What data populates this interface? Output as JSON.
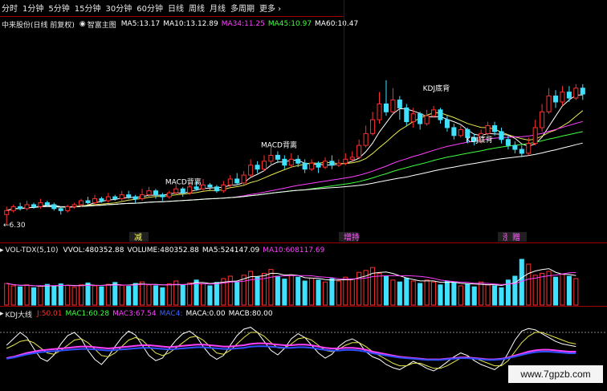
{
  "toolbar": {
    "items": [
      "分时",
      "1分钟",
      "5分钟",
      "15分钟",
      "30分钟",
      "60分钟",
      "日线",
      "周线",
      "月线",
      "多周期",
      "更多"
    ]
  },
  "main_panel": {
    "title": "中来股份(日线 前复权)",
    "indicator": "智富主图",
    "ma": [
      {
        "label": "MA5:",
        "value": "13.17",
        "color": "#ffffff"
      },
      {
        "label": "MA10:",
        "value": "13.12.89",
        "color": "#ffffff"
      },
      {
        "label": "MA34:",
        "value": "11.25",
        "color": "#ff40ff"
      },
      {
        "label": "MA45:",
        "value": "10.97",
        "color": "#40ff40"
      },
      {
        "label": "MA60:",
        "value": "10.47",
        "color": "#ffffff"
      }
    ],
    "low_price": "6.30",
    "annotations": [
      "MACD背离",
      "MACD背离",
      "KDJ底背",
      "KDJ底背"
    ],
    "bottom_markers": [
      "减",
      "增持",
      "涨",
      "赠"
    ]
  },
  "vol_panel": {
    "title": "VOL-TDX(5,10)",
    "items": [
      {
        "label": "VVOL:",
        "value": "480352.88",
        "color": "#ffffff"
      },
      {
        "label": "VOLUME:",
        "value": "480352.88",
        "color": "#ffffff"
      },
      {
        "label": "MA5:",
        "value": "524147.09",
        "color": "#ffffff"
      },
      {
        "label": "MA10:",
        "value": "608117.69",
        "color": "#ff40ff"
      }
    ]
  },
  "kdj_panel": {
    "title": "KDJ大线",
    "items": [
      {
        "label": "J:",
        "value": "50.01",
        "color": "#ff3030"
      },
      {
        "label": "MAC1:",
        "value": "60.28",
        "color": "#40ff40"
      },
      {
        "label": "MAC3:",
        "value": "67.54",
        "color": "#ff40ff"
      },
      {
        "label": "MAC4:",
        "value": "",
        "color": "#4060ff"
      },
      {
        "label": "MACA:",
        "value": "0.00",
        "color": "#ffffff"
      },
      {
        "label": "MACB:",
        "value": "80.00",
        "color": "#ffffff"
      }
    ]
  },
  "watermark": "www.7gpzb.com",
  "chart_data": {
    "type": "candlestick",
    "title": "中来股份(日线 前复权)",
    "y_min_label": 6.3,
    "series_names": [
      "MA5",
      "MA10",
      "MA34",
      "MA45",
      "MA60"
    ],
    "colors": {
      "up": "#ff3030",
      "down": "#40e0ff",
      "ma5": "#ffffff",
      "ma10": "#e8e850",
      "ma34": "#ff40ff",
      "ma45": "#40ff40",
      "ma60": "#ffffff",
      "k": "#ffffff",
      "d": "#e8e850",
      "j": "#ff40ff"
    },
    "candles": [
      {
        "o": 6.8,
        "c": 7.0,
        "h": 7.2,
        "l": 6.3
      },
      {
        "o": 7.0,
        "c": 7.2,
        "h": 7.3,
        "l": 6.9
      },
      {
        "o": 7.2,
        "c": 7.1,
        "h": 7.4,
        "l": 7.0
      },
      {
        "o": 7.1,
        "c": 7.3,
        "h": 7.5,
        "l": 7.0
      },
      {
        "o": 7.3,
        "c": 7.2,
        "h": 7.4,
        "l": 7.1
      },
      {
        "o": 7.2,
        "c": 7.4,
        "h": 7.6,
        "l": 7.1
      },
      {
        "o": 7.4,
        "c": 7.3,
        "h": 7.5,
        "l": 7.2
      },
      {
        "o": 7.3,
        "c": 7.1,
        "h": 7.4,
        "l": 7.0
      },
      {
        "o": 7.1,
        "c": 7.0,
        "h": 7.2,
        "l": 6.8
      },
      {
        "o": 7.0,
        "c": 7.2,
        "h": 7.3,
        "l": 6.9
      },
      {
        "o": 7.2,
        "c": 7.3,
        "h": 7.4,
        "l": 7.1
      },
      {
        "o": 7.3,
        "c": 7.5,
        "h": 7.6,
        "l": 7.2
      },
      {
        "o": 7.5,
        "c": 7.4,
        "h": 7.7,
        "l": 7.3
      },
      {
        "o": 7.4,
        "c": 7.6,
        "h": 7.8,
        "l": 7.3
      },
      {
        "o": 7.6,
        "c": 7.5,
        "h": 7.7,
        "l": 7.4
      },
      {
        "o": 7.5,
        "c": 7.7,
        "h": 7.9,
        "l": 7.4
      },
      {
        "o": 7.7,
        "c": 7.6,
        "h": 7.8,
        "l": 7.5
      },
      {
        "o": 7.6,
        "c": 7.8,
        "h": 8.0,
        "l": 7.5
      },
      {
        "o": 7.8,
        "c": 7.7,
        "h": 8.0,
        "l": 7.6
      },
      {
        "o": 7.7,
        "c": 7.6,
        "h": 7.8,
        "l": 7.4
      },
      {
        "o": 7.6,
        "c": 7.8,
        "h": 8.1,
        "l": 7.5
      },
      {
        "o": 7.8,
        "c": 8.0,
        "h": 8.2,
        "l": 7.7
      },
      {
        "o": 8.0,
        "c": 7.8,
        "h": 8.1,
        "l": 7.6
      },
      {
        "o": 7.8,
        "c": 7.7,
        "h": 7.9,
        "l": 7.5
      },
      {
        "o": 7.7,
        "c": 7.9,
        "h": 8.0,
        "l": 7.6
      },
      {
        "o": 7.9,
        "c": 8.1,
        "h": 8.3,
        "l": 7.8
      },
      {
        "o": 8.1,
        "c": 7.9,
        "h": 8.2,
        "l": 7.7
      },
      {
        "o": 7.9,
        "c": 8.2,
        "h": 8.4,
        "l": 7.8
      },
      {
        "o": 8.2,
        "c": 8.1,
        "h": 8.5,
        "l": 8.0
      },
      {
        "o": 8.1,
        "c": 8.3,
        "h": 8.6,
        "l": 8.0
      },
      {
        "o": 8.3,
        "c": 8.2,
        "h": 8.4,
        "l": 8.0
      },
      {
        "o": 8.2,
        "c": 8.0,
        "h": 8.3,
        "l": 7.9
      },
      {
        "o": 8.0,
        "c": 8.3,
        "h": 8.5,
        "l": 7.9
      },
      {
        "o": 8.3,
        "c": 8.6,
        "h": 8.8,
        "l": 8.2
      },
      {
        "o": 8.6,
        "c": 8.4,
        "h": 8.9,
        "l": 8.3
      },
      {
        "o": 8.4,
        "c": 8.8,
        "h": 9.0,
        "l": 8.3
      },
      {
        "o": 8.8,
        "c": 9.3,
        "h": 9.6,
        "l": 8.7
      },
      {
        "o": 9.3,
        "c": 9.1,
        "h": 9.5,
        "l": 8.9
      },
      {
        "o": 9.1,
        "c": 9.5,
        "h": 9.8,
        "l": 9.0
      },
      {
        "o": 9.5,
        "c": 9.8,
        "h": 10.2,
        "l": 9.3
      },
      {
        "o": 9.8,
        "c": 9.6,
        "h": 10.0,
        "l": 9.4
      },
      {
        "o": 9.6,
        "c": 9.3,
        "h": 9.8,
        "l": 9.1
      },
      {
        "o": 9.3,
        "c": 9.6,
        "h": 9.9,
        "l": 9.2
      },
      {
        "o": 9.6,
        "c": 9.4,
        "h": 9.8,
        "l": 9.2
      },
      {
        "o": 9.4,
        "c": 9.1,
        "h": 9.6,
        "l": 8.9
      },
      {
        "o": 9.1,
        "c": 9.4,
        "h": 9.6,
        "l": 9.0
      },
      {
        "o": 9.4,
        "c": 9.2,
        "h": 9.5,
        "l": 8.9
      },
      {
        "o": 9.2,
        "c": 9.5,
        "h": 9.7,
        "l": 9.1
      },
      {
        "o": 9.5,
        "c": 9.3,
        "h": 9.8,
        "l": 9.1
      },
      {
        "o": 9.3,
        "c": 9.4,
        "h": 9.6,
        "l": 9.2
      },
      {
        "o": 9.4,
        "c": 9.6,
        "h": 9.9,
        "l": 9.3
      },
      {
        "o": 9.6,
        "c": 9.7,
        "h": 10.0,
        "l": 9.5
      },
      {
        "o": 9.7,
        "c": 10.3,
        "h": 10.6,
        "l": 9.6
      },
      {
        "o": 10.3,
        "c": 10.9,
        "h": 11.3,
        "l": 10.2
      },
      {
        "o": 10.9,
        "c": 11.6,
        "h": 12.0,
        "l": 10.8
      },
      {
        "o": 11.6,
        "c": 12.4,
        "h": 13.0,
        "l": 11.4
      },
      {
        "o": 12.4,
        "c": 12.0,
        "h": 13.6,
        "l": 11.8
      },
      {
        "o": 12.0,
        "c": 12.6,
        "h": 13.2,
        "l": 11.9
      },
      {
        "o": 12.6,
        "c": 12.2,
        "h": 12.8,
        "l": 11.6
      },
      {
        "o": 12.2,
        "c": 11.5,
        "h": 12.4,
        "l": 11.3
      },
      {
        "o": 11.5,
        "c": 11.9,
        "h": 12.2,
        "l": 11.2
      },
      {
        "o": 11.9,
        "c": 11.4,
        "h": 12.0,
        "l": 11.1
      },
      {
        "o": 11.4,
        "c": 11.8,
        "h": 12.1,
        "l": 11.3
      },
      {
        "o": 11.8,
        "c": 12.1,
        "h": 12.3,
        "l": 11.7
      },
      {
        "o": 12.1,
        "c": 11.6,
        "h": 12.2,
        "l": 11.4
      },
      {
        "o": 11.6,
        "c": 11.2,
        "h": 11.8,
        "l": 11.0
      },
      {
        "o": 11.2,
        "c": 10.8,
        "h": 11.4,
        "l": 10.6
      },
      {
        "o": 10.8,
        "c": 11.1,
        "h": 11.3,
        "l": 10.7
      },
      {
        "o": 11.1,
        "c": 10.7,
        "h": 11.2,
        "l": 10.4
      },
      {
        "o": 10.7,
        "c": 10.5,
        "h": 10.9,
        "l": 10.3
      },
      {
        "o": 10.5,
        "c": 10.9,
        "h": 11.1,
        "l": 10.4
      },
      {
        "o": 10.9,
        "c": 11.3,
        "h": 11.5,
        "l": 10.8
      },
      {
        "o": 11.3,
        "c": 11.0,
        "h": 11.5,
        "l": 10.8
      },
      {
        "o": 11.0,
        "c": 10.6,
        "h": 11.2,
        "l": 10.4
      },
      {
        "o": 10.6,
        "c": 10.3,
        "h": 10.8,
        "l": 10.1
      },
      {
        "o": 10.3,
        "c": 10.1,
        "h": 10.5,
        "l": 9.9
      },
      {
        "o": 10.1,
        "c": 9.9,
        "h": 10.3,
        "l": 9.7
      },
      {
        "o": 9.9,
        "c": 10.4,
        "h": 10.7,
        "l": 9.8
      },
      {
        "o": 10.4,
        "c": 11.2,
        "h": 11.6,
        "l": 10.3
      },
      {
        "o": 11.2,
        "c": 12.0,
        "h": 12.4,
        "l": 11.0
      },
      {
        "o": 12.0,
        "c": 12.8,
        "h": 13.2,
        "l": 11.9
      },
      {
        "o": 12.8,
        "c": 12.5,
        "h": 13.1,
        "l": 12.2
      },
      {
        "o": 12.5,
        "c": 13.0,
        "h": 13.3,
        "l": 12.3
      },
      {
        "o": 13.0,
        "c": 12.7,
        "h": 13.3,
        "l": 12.5
      },
      {
        "o": 12.7,
        "c": 13.2,
        "h": 13.4,
        "l": 12.6
      },
      {
        "o": 13.2,
        "c": 12.9,
        "h": 13.4,
        "l": 12.6
      }
    ],
    "volume": [
      0.45,
      0.4,
      0.38,
      0.42,
      0.36,
      0.4,
      0.43,
      0.39,
      0.44,
      0.41,
      0.37,
      0.42,
      0.46,
      0.4,
      0.38,
      0.43,
      0.47,
      0.41,
      0.39,
      0.45,
      0.48,
      0.42,
      0.4,
      0.36,
      0.44,
      0.5,
      0.42,
      0.46,
      0.52,
      0.44,
      0.4,
      0.47,
      0.55,
      0.6,
      0.48,
      0.62,
      0.7,
      0.58,
      0.66,
      0.74,
      0.6,
      0.54,
      0.62,
      0.58,
      0.5,
      0.56,
      0.52,
      0.48,
      0.55,
      0.5,
      0.58,
      0.54,
      0.68,
      0.72,
      0.78,
      0.66,
      0.6,
      0.52,
      0.48,
      0.56,
      0.5,
      0.45,
      0.52,
      0.48,
      0.42,
      0.5,
      0.46,
      0.4,
      0.44,
      0.38,
      0.48,
      0.42,
      0.4,
      0.36,
      0.52,
      0.6,
      0.95,
      0.85,
      0.62,
      0.66,
      0.7,
      0.58,
      0.64,
      0.6,
      0.55
    ],
    "kdj_k": [
      60,
      70,
      80,
      72,
      55,
      40,
      35,
      45,
      62,
      75,
      80,
      70,
      52,
      38,
      30,
      42,
      58,
      72,
      82,
      76,
      60,
      44,
      36,
      40,
      55,
      68,
      78,
      82,
      74,
      58,
      45,
      38,
      44,
      60,
      75,
      85,
      88,
      80,
      66,
      52,
      45,
      55,
      70,
      78,
      72,
      60,
      48,
      40,
      46,
      58,
      66,
      70,
      64,
      50,
      42,
      38,
      30,
      25,
      22,
      28,
      35,
      30,
      24,
      20,
      26,
      34,
      42,
      48,
      44,
      36,
      30,
      26,
      22,
      30,
      48,
      68,
      82,
      86,
      84,
      78,
      72,
      66,
      62,
      60,
      58
    ],
    "kdj_d": [
      55,
      60,
      66,
      68,
      64,
      56,
      48,
      46,
      52,
      60,
      68,
      70,
      64,
      54,
      44,
      42,
      48,
      58,
      68,
      72,
      68,
      58,
      48,
      44,
      48,
      56,
      64,
      72,
      74,
      68,
      58,
      48,
      46,
      52,
      62,
      72,
      80,
      80,
      74,
      64,
      56,
      55,
      62,
      70,
      72,
      68,
      60,
      52,
      50,
      54,
      60,
      64,
      64,
      58,
      50,
      44,
      38,
      32,
      28,
      28,
      32,
      32,
      28,
      24,
      24,
      28,
      34,
      40,
      42,
      40,
      36,
      32,
      28,
      28,
      36,
      50,
      64,
      74,
      80,
      80,
      76,
      72,
      68,
      64,
      62
    ],
    "kdj_j": [
      40,
      42,
      45,
      48,
      50,
      52,
      53,
      54,
      55,
      56,
      57,
      58,
      58,
      57,
      56,
      55,
      56,
      57,
      58,
      59,
      60,
      60,
      59,
      58,
      57,
      58,
      59,
      60,
      61,
      61,
      60,
      59,
      58,
      58,
      59,
      60,
      62,
      63,
      63,
      62,
      61,
      60,
      60,
      61,
      61,
      60,
      58,
      56,
      55,
      55,
      56,
      56,
      55,
      53,
      50,
      48,
      46,
      44,
      42,
      41,
      40,
      39,
      38,
      38,
      38,
      39,
      40,
      41,
      41,
      40,
      39,
      38,
      38,
      39,
      41,
      44,
      47,
      50,
      52,
      53,
      53,
      52,
      51,
      50,
      50
    ]
  }
}
